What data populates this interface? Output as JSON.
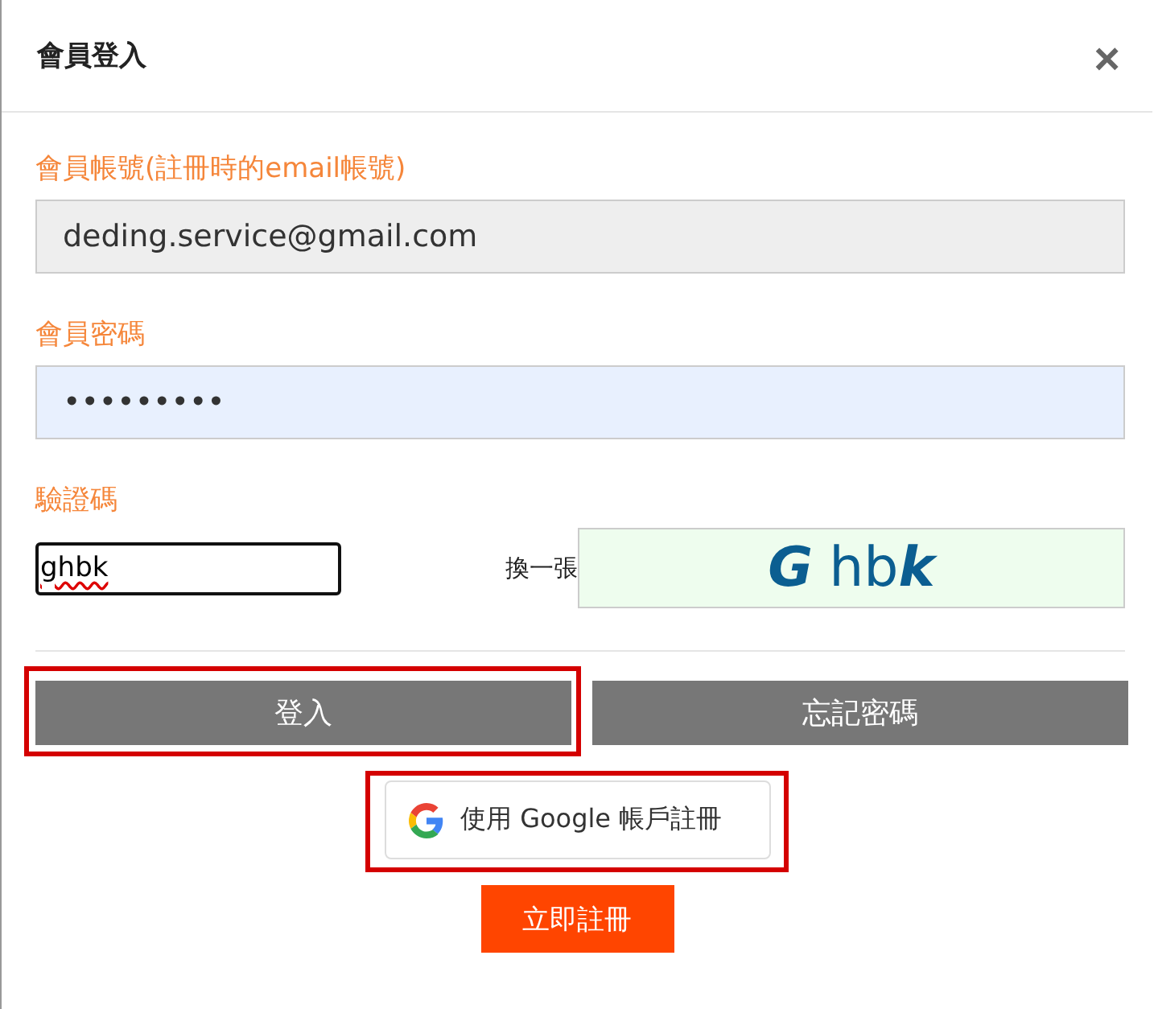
{
  "dialog": {
    "title": "會員登入",
    "close": "×"
  },
  "fields": [
    {
      "kind": "text",
      "label": "會員帳號(註冊時的email帳號)",
      "value": "deding.service@gmail.com"
    },
    {
      "kind": "password",
      "label": "會員密碼",
      "value": "•••••••••"
    }
  ],
  "captcha": {
    "label": "驗證碼",
    "value": "ghbk",
    "refresh": "換一張",
    "image_text": [
      {
        "text": "G",
        "italic": true
      },
      {
        "text": "hb",
        "italic": false
      },
      {
        "text": "k",
        "italic": true
      }
    ]
  },
  "buttons": [
    {
      "label": "登入",
      "highlighted": true
    },
    {
      "label": "忘記密碼",
      "highlighted": false
    }
  ],
  "google_button": {
    "label": "使用 Google 帳戶註冊",
    "highlighted": true
  },
  "register_button": {
    "label": "立即註冊"
  }
}
